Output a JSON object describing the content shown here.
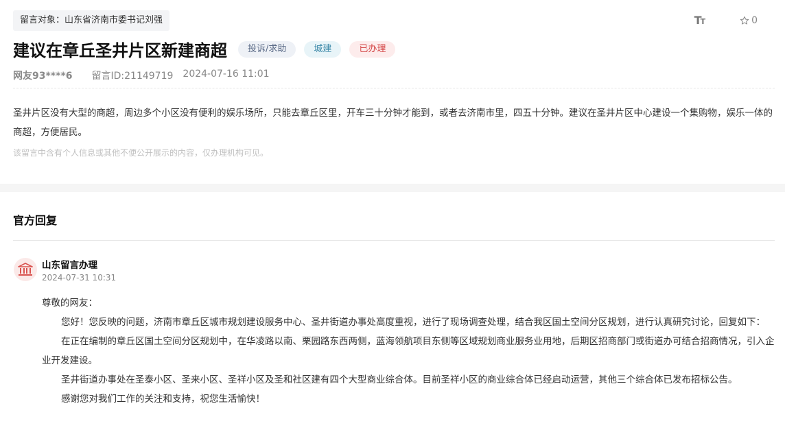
{
  "message": {
    "target_label": "留言对象：山东省济南市委书记刘强",
    "title": "建议在章丘圣井片区新建商超",
    "tags": {
      "type": "投诉/求助",
      "category": "城建",
      "status": "已办理"
    },
    "user": "网友93****6",
    "id_label": "留言ID:21149719",
    "datetime": "2024-07-16 11:01",
    "content": "圣井片区没有大型的商超，周边多个小区没有便利的娱乐场所，只能去章丘区里，开车三十分钟才能到，或者去济南市里，四五十分钟。建议在圣井片区中心建设一个集购物，娱乐一体的商超，方便居民。",
    "privacy_note": "该留言中含有个人信息或其他不便公开展示的内容，仅办理机构可见。"
  },
  "toolbar": {
    "font_size_icon": "font-size-icon",
    "star_icon": "star-icon",
    "star_count": "0"
  },
  "reply": {
    "heading": "官方回复",
    "org_icon": "government-building-icon",
    "org_name": "山东留言办理",
    "datetime": "2024-07-31 10:31",
    "greeting": "尊敬的网友：",
    "paragraphs": [
      "您好！您反映的问题，济南市章丘区城市规划建设服务中心、圣井街道办事处高度重视，进行了现场调查处理，结合我区国土空间分区规划，进行认真研究讨论，回复如下：",
      "在正在编制的章丘区国土空间分区规划中，在华凌路以南、栗园路东西两侧，蓝海领航项目东侧等区域规划商业服务业用地，后期区招商部门或街道办可结合招商情况，引入企业开发建设。",
      "圣井街道办事处在圣泰小区、圣来小区、圣祥小区及圣和社区建有四个大型商业综合体。目前圣祥小区的商业综合体已经启动运营，其他三个综合体已发布招标公告。",
      "感谢您对我们工作的关注和支持，祝您生活愉快！"
    ]
  },
  "colors": {
    "tag_type_bg": "#eef1f6",
    "tag_category_bg": "#e8f4f8",
    "tag_status_bg": "#fdecec",
    "tag_status_text": "#d44848",
    "avatar_bg": "#fbe9e8",
    "avatar_icon": "#d9534f"
  }
}
